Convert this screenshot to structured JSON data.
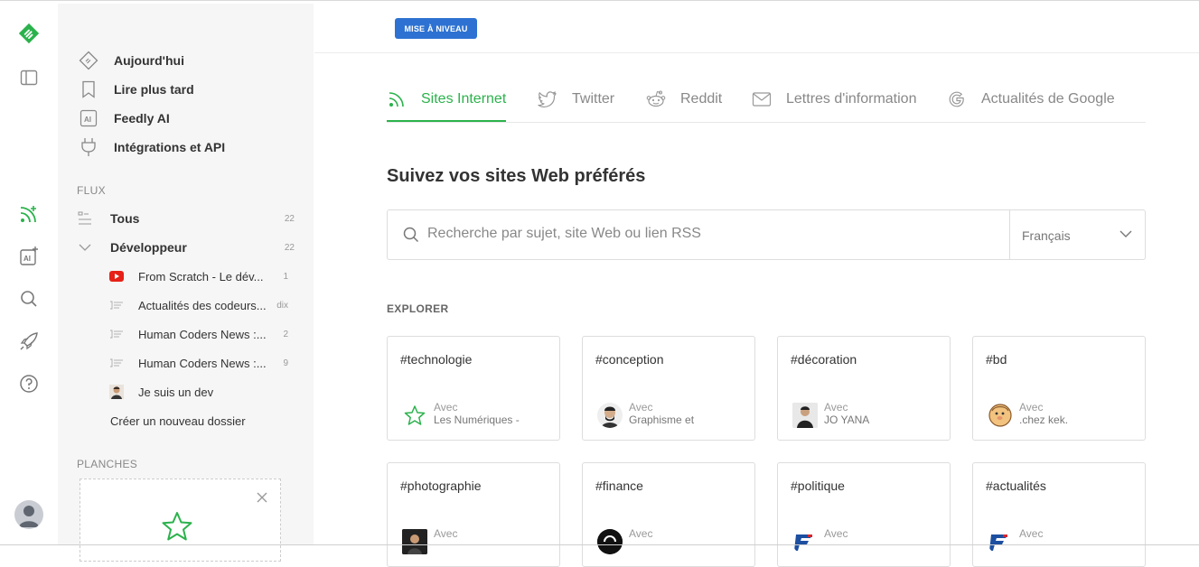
{
  "sidebar": {
    "nav": [
      {
        "label": "Aujourd'hui",
        "icon": "today-icon"
      },
      {
        "label": "Lire plus tard",
        "icon": "bookmark-icon"
      },
      {
        "label": "Feedly AI",
        "icon": "ai-badge-icon"
      },
      {
        "label": "Intégrations et API",
        "icon": "plug-icon"
      }
    ],
    "flux_title": "FLUX",
    "all": {
      "label": "Tous",
      "count": "22"
    },
    "folder": {
      "label": "Développeur",
      "count": "22"
    },
    "sources": [
      {
        "label": "From Scratch - Le dév...",
        "count": "1",
        "icon": "youtube-icon"
      },
      {
        "label": "Actualités des codeurs...",
        "count": "dix",
        "icon": "feed-thumbnail-icon"
      },
      {
        "label": "Human Coders News :...",
        "count": "2",
        "icon": "feed-thumbnail-icon"
      },
      {
        "label": "Human Coders News :...",
        "count": "9",
        "icon": "feed-thumbnail-icon"
      },
      {
        "label": "Je suis un dev",
        "count": "",
        "icon": "person-avatar-icon"
      }
    ],
    "create_folder": "Créer un nouveau dossier",
    "boards_title": "PLANCHES"
  },
  "header": {
    "upgrade_label": "MISE À NIVEAU"
  },
  "tabs": [
    {
      "label": "Sites Internet",
      "icon": "rss-icon",
      "active": true
    },
    {
      "label": "Twitter",
      "icon": "twitter-icon",
      "active": false
    },
    {
      "label": "Reddit",
      "icon": "reddit-icon",
      "active": false
    },
    {
      "label": "Lettres d'information",
      "icon": "mail-icon",
      "active": false
    },
    {
      "label": "Actualités de Google",
      "icon": "google-icon",
      "active": false
    }
  ],
  "main": {
    "heading": "Suivez vos sites Web préférés",
    "search_placeholder": "Recherche par sujet, site Web ou lien RSS",
    "language": "Français",
    "explorer_title": "EXPLORER"
  },
  "cards": [
    {
      "tag": "#technologie",
      "with": "Avec",
      "source": "Les Numériques -"
    },
    {
      "tag": "#conception",
      "with": "Avec",
      "source": "Graphisme et"
    },
    {
      "tag": "#décoration",
      "with": "Avec",
      "source": "JO YANA"
    },
    {
      "tag": "#bd",
      "with": "Avec",
      "source": ".chez kek."
    },
    {
      "tag": "#photographie",
      "with": "Avec",
      "source": ""
    },
    {
      "tag": "#finance",
      "with": "Avec",
      "source": ""
    },
    {
      "tag": "#politique",
      "with": "Avec",
      "source": ""
    },
    {
      "tag": "#actualités",
      "with": "Avec",
      "source": ""
    }
  ],
  "colors": {
    "accent": "#2bb24c",
    "upgrade": "#2d72d2",
    "sidebar_bg": "#f6f6f6"
  }
}
